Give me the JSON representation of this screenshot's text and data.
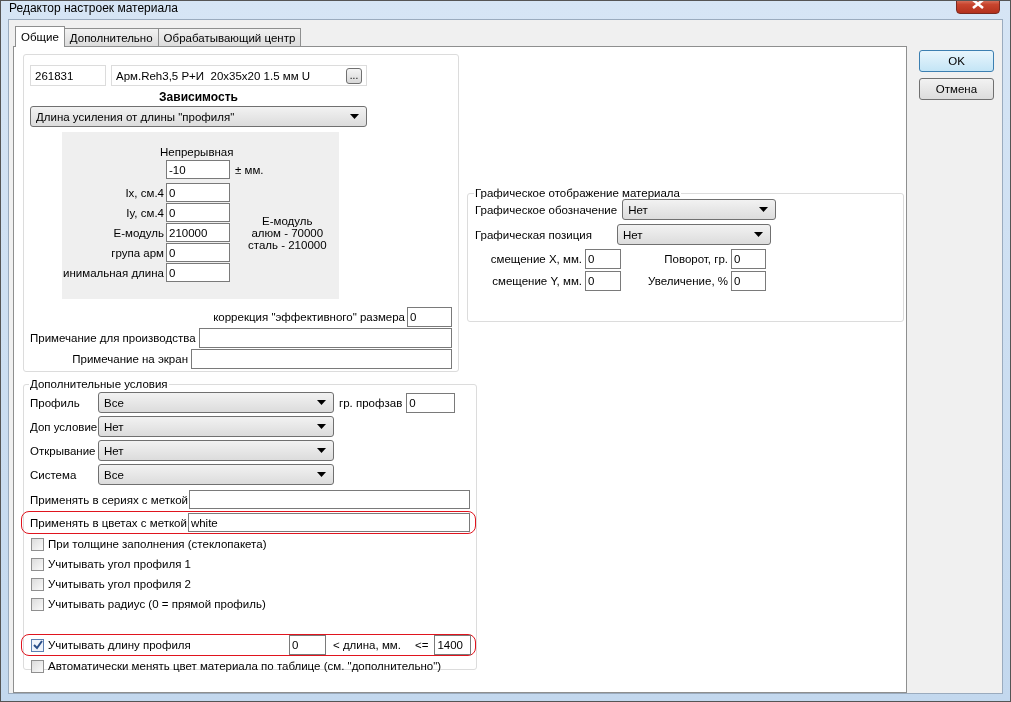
{
  "window": {
    "title": "Редактор настроек материала"
  },
  "tabs": [
    {
      "label": "Общие",
      "selected": true
    },
    {
      "label": "Дополнительно",
      "selected": false
    },
    {
      "label": "Обрабатывающий центр",
      "selected": false
    }
  ],
  "buttons": [
    {
      "label": "OK",
      "default": true
    },
    {
      "label": "Отмена",
      "default": false
    }
  ],
  "general": {
    "code": "261831",
    "name": "Арм.Reh3,5 P+И  20x35x20 1.5 мм U",
    "browse": "...",
    "dependency_title": "Зависимость",
    "dependency": "Длина усиления от длины \"профиля\"",
    "panel": {
      "mode": "Непрерывная",
      "tolerance": "-10",
      "tolerance_unit": "± мм.",
      "fields": [
        {
          "label": "Ix, см.4",
          "value": "0"
        },
        {
          "label": "Iy, см.4",
          "value": "0"
        },
        {
          "label": "Е-модуль",
          "value": "210000"
        },
        {
          "label": "група арм",
          "value": "0"
        },
        {
          "label": "инимальная длина",
          "value": "0"
        }
      ],
      "note": [
        "Е-модуль",
        "алюм - 70000",
        "сталь - 210000"
      ]
    },
    "correction": {
      "label": "коррекция \"эффективного\" размера",
      "value": "0"
    },
    "notes": [
      {
        "label": "Примечание для производства"
      },
      {
        "label": "Примечание на экран"
      }
    ]
  },
  "conditions": {
    "title": "Дополнительные условия",
    "selects": [
      {
        "label": "Профиль",
        "value": "Все"
      },
      {
        "label": "Доп условие",
        "value": "Нет"
      },
      {
        "label": "Открывание",
        "value": "Нет"
      },
      {
        "label": "Система",
        "value": "Все"
      }
    ],
    "group": {
      "label": "гр. профзав",
      "value": "0"
    },
    "tags": [
      {
        "label": "Применять в сериях с меткой",
        "highlighted": false
      },
      {
        "label": "Применять в цветах с меткой",
        "value": "white",
        "highlighted": true
      }
    ],
    "checks": [
      {
        "label": "При толщине заполнения (стеклопакета)",
        "checked": false
      },
      {
        "label": "Учитывать угол профиля 1",
        "checked": false
      },
      {
        "label": "Учитывать угол профиля 2",
        "checked": false
      },
      {
        "label": "Учитывать радиус (0 = прямой профиль)",
        "checked": false
      }
    ],
    "length": {
      "label": "Учитывать длину профиля",
      "checked": true,
      "highlighted": true,
      "min": "0",
      "between": "< длина, мм.",
      "le": "<=",
      "max": "1400"
    },
    "auto": {
      "label": "Автоматически менять цвет материала по таблице (см. \"дополнительно\")",
      "checked": false
    }
  },
  "graphics": {
    "title": "Графическое отображение материала",
    "selects": [
      {
        "label": "Графическое обозначение",
        "value": "Нет"
      },
      {
        "label": "Графическая позиция",
        "value": "Нет"
      }
    ],
    "offsets": [
      {
        "label": "смещение X, мм.",
        "value": "0"
      },
      {
        "label": "смещение Y, мм.",
        "value": "0"
      }
    ],
    "transforms": [
      {
        "label": "Поворот, гр.",
        "value": "0"
      },
      {
        "label": "Увеличение, %",
        "value": "0"
      }
    ]
  }
}
